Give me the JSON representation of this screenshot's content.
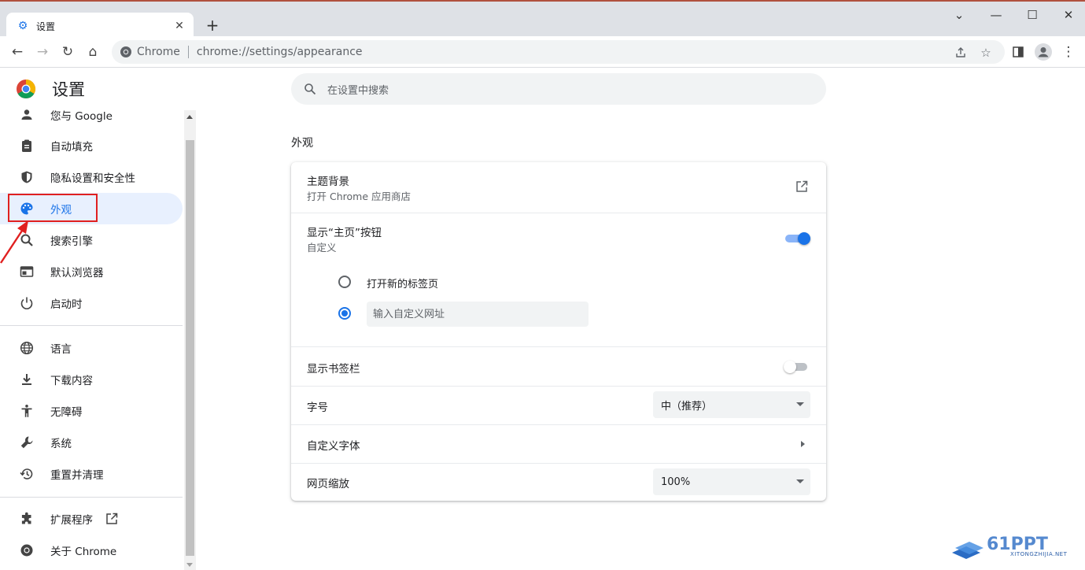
{
  "tab": {
    "title": "设置",
    "close_glyph": "✕"
  },
  "new_tab_glyph": "+",
  "window_controls": {
    "dropdown": "⌄",
    "minimize": "—",
    "maximize": "☐",
    "close": "✕"
  },
  "toolbar": {
    "back": "←",
    "forward": "→",
    "reload": "↻",
    "home": "⌂",
    "omnibox_chip": "Chrome",
    "url": "chrome://settings/appearance"
  },
  "brand": {
    "title": "设置"
  },
  "nav": {
    "items": [
      {
        "label": "您与 Google",
        "icon": "person-icon"
      },
      {
        "label": "自动填充",
        "icon": "clipboard-icon"
      },
      {
        "label": "隐私设置和安全性",
        "icon": "shield-icon"
      },
      {
        "label": "外观",
        "icon": "palette-icon",
        "active": true
      },
      {
        "label": "搜索引擎",
        "icon": "search-icon"
      },
      {
        "label": "默认浏览器",
        "icon": "browser-window-icon"
      },
      {
        "label": "启动时",
        "icon": "power-icon"
      },
      {
        "label": "语言",
        "icon": "globe-icon"
      },
      {
        "label": "下载内容",
        "icon": "download-icon"
      },
      {
        "label": "无障碍",
        "icon": "accessibility-icon"
      },
      {
        "label": "系统",
        "icon": "wrench-icon"
      },
      {
        "label": "重置并清理",
        "icon": "history-icon"
      },
      {
        "label": "扩展程序",
        "icon": "puzzle-icon"
      },
      {
        "label": "关于 Chrome",
        "icon": "chrome-icon"
      }
    ]
  },
  "search": {
    "placeholder": "在设置中搜索"
  },
  "section": {
    "title": "外观"
  },
  "card": {
    "theme": {
      "title": "主题背景",
      "subtitle": "打开 Chrome 应用商店"
    },
    "home_button": {
      "title": "显示“主页”按钮",
      "subtitle": "自定义",
      "enabled": true,
      "option_new_tab": "打开新的标签页",
      "custom_url_placeholder": "输入自定义网址"
    },
    "bookmarks_bar": {
      "title": "显示书签栏",
      "enabled": false
    },
    "font_size": {
      "title": "字号",
      "selected": "中（推荐）"
    },
    "custom_fonts": {
      "title": "自定义字体"
    },
    "page_zoom": {
      "title": "网页缩放",
      "selected": "100%"
    }
  },
  "colors": {
    "accent": "#1a73e8",
    "nav_active_bg": "#e8f0fe",
    "annotation_red": "#e02020"
  },
  "watermark": {
    "domain": "XITONGZHIJIA.NET"
  }
}
